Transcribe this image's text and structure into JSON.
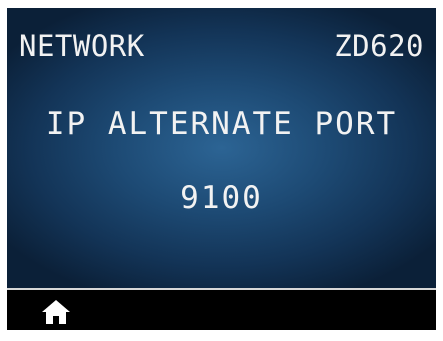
{
  "header": {
    "menu": "NETWORK",
    "model": "ZD620"
  },
  "parameter": {
    "title": "IP ALTERNATE PORT",
    "value": "9100"
  },
  "bottom_bar": {
    "home_icon": "home-icon"
  },
  "colors": {
    "background_center": "#2c6494",
    "background_edge": "#0b2038",
    "text": "#f2f2f2",
    "bar": "#000000"
  }
}
